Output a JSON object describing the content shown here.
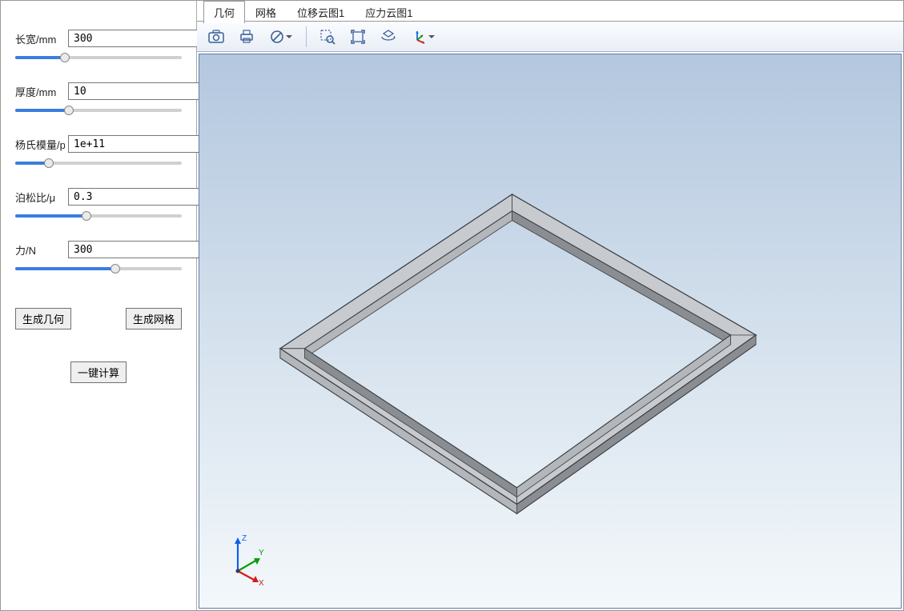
{
  "params": [
    {
      "label": "长宽/mm",
      "value": "300",
      "slider_pct": 30
    },
    {
      "label": "厚度/mm",
      "value": "10",
      "slider_pct": 32
    },
    {
      "label": "杨氏模量/po",
      "value": "1e+11",
      "slider_pct": 20
    },
    {
      "label": "泊松比/μ",
      "value": "0.3",
      "slider_pct": 43
    },
    {
      "label": "力/N",
      "value": "300",
      "slider_pct": 60
    }
  ],
  "buttons": {
    "gen_geom": "生成几何",
    "gen_mesh": "生成网格",
    "compute": "一键计算"
  },
  "tabs": [
    {
      "label": "几何",
      "active": true
    },
    {
      "label": "网格",
      "active": false
    },
    {
      "label": "位移云图1",
      "active": false
    },
    {
      "label": "应力云图1",
      "active": false
    }
  ],
  "toolbar_icons": [
    "camera-icon",
    "print-icon",
    "noentry-icon",
    "sep",
    "zoom-select-icon",
    "fit-screen-icon",
    "rotate3d-icon",
    "axes-icon"
  ],
  "triad": {
    "x": "X",
    "y": "Y",
    "z": "Z"
  },
  "colors": {
    "accent": "#3a7de0",
    "edge": "#555a5d",
    "face_light": "#cfd3d6",
    "face_dark": "#8d9195"
  }
}
